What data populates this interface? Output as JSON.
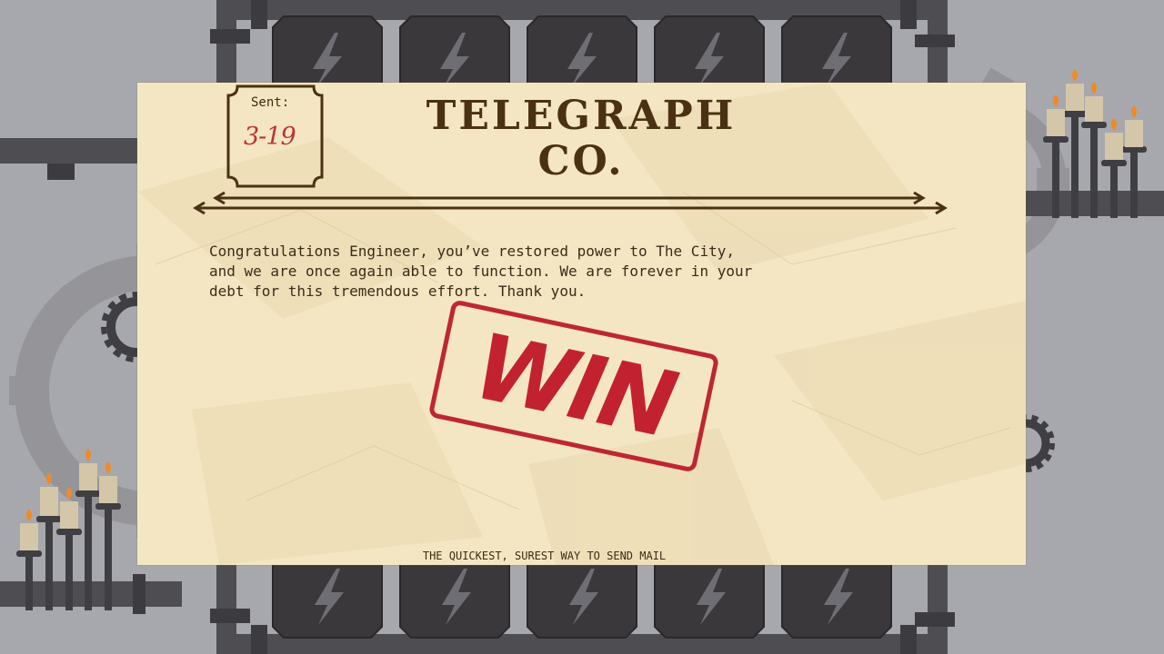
{
  "telegram": {
    "sent_label": "Sent:",
    "sent_date": "3-19",
    "title_line1": "TELEGRAPH",
    "title_line2": "CO.",
    "message": "Congratulations Engineer, you’ve restored power to The City,\nand we are once again able to function. We are forever in your\ndebt for this tremendous effort. Thank you.",
    "stamp": "WIN",
    "footer": "THE QUICKEST, SUREST WAY TO SEND MAIL"
  },
  "colors": {
    "background": "#a7a8ad",
    "paper": "#f4e6c2",
    "ink_brown": "#4a3114",
    "stamp_red": "#c22130",
    "battery": "#3b383c",
    "pipe": "#4e4e52",
    "candle": "#d4c6a8",
    "flame": "#f08a24"
  }
}
